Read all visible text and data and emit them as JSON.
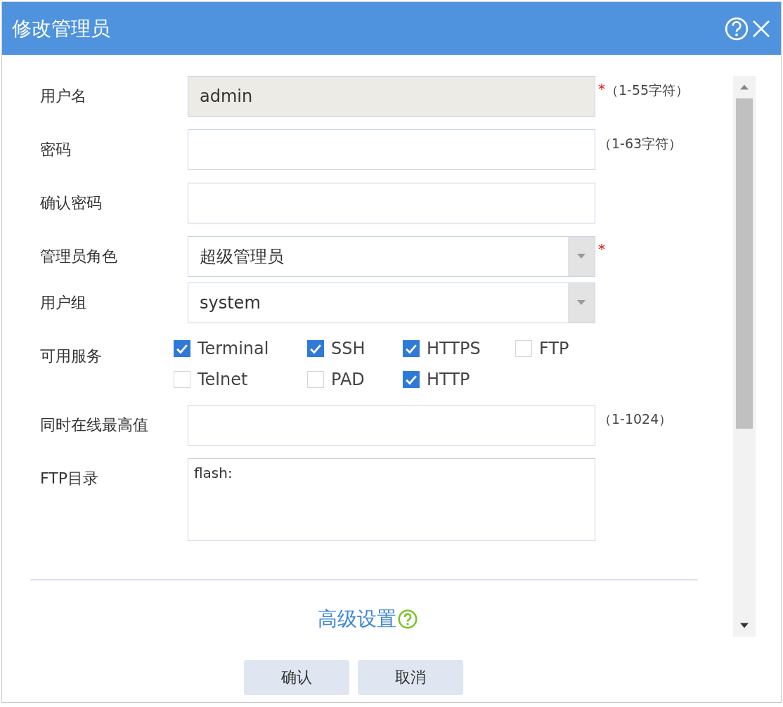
{
  "dialog": {
    "title": "修改管理员"
  },
  "fields": [
    {
      "kind": "text",
      "label": "用户名",
      "value": "admin",
      "disabled": true,
      "required_mark": "*",
      "hint": "（1-55字符）"
    },
    {
      "kind": "text",
      "label": "密码",
      "disabled": false,
      "hint": "（1-63字符）"
    },
    {
      "kind": "text",
      "label": "确认密码",
      "disabled": false
    },
    {
      "kind": "select",
      "label": "管理员角色",
      "value": "超级管理员",
      "required_mark": "*"
    },
    {
      "kind": "select",
      "label": "用户组",
      "value": "system"
    },
    {
      "kind": "checks",
      "label": "可用服务",
      "options": [
        {
          "label": "Terminal",
          "checked": true
        },
        {
          "label": "SSH",
          "checked": true
        },
        {
          "label": "HTTPS",
          "checked": true
        },
        {
          "label": "FTP",
          "checked": false
        },
        {
          "label": "Telnet",
          "checked": false
        },
        {
          "label": "PAD",
          "checked": false
        },
        {
          "label": "HTTP",
          "checked": true
        }
      ]
    },
    {
      "kind": "text",
      "label": "同时在线最高值",
      "disabled": false,
      "hint": "（1-1024）"
    },
    {
      "kind": "textarea",
      "label": "FTP目录",
      "value": "flash:"
    }
  ],
  "advanced_link": "高级设置",
  "buttons": [
    "确认",
    "取消"
  ]
}
